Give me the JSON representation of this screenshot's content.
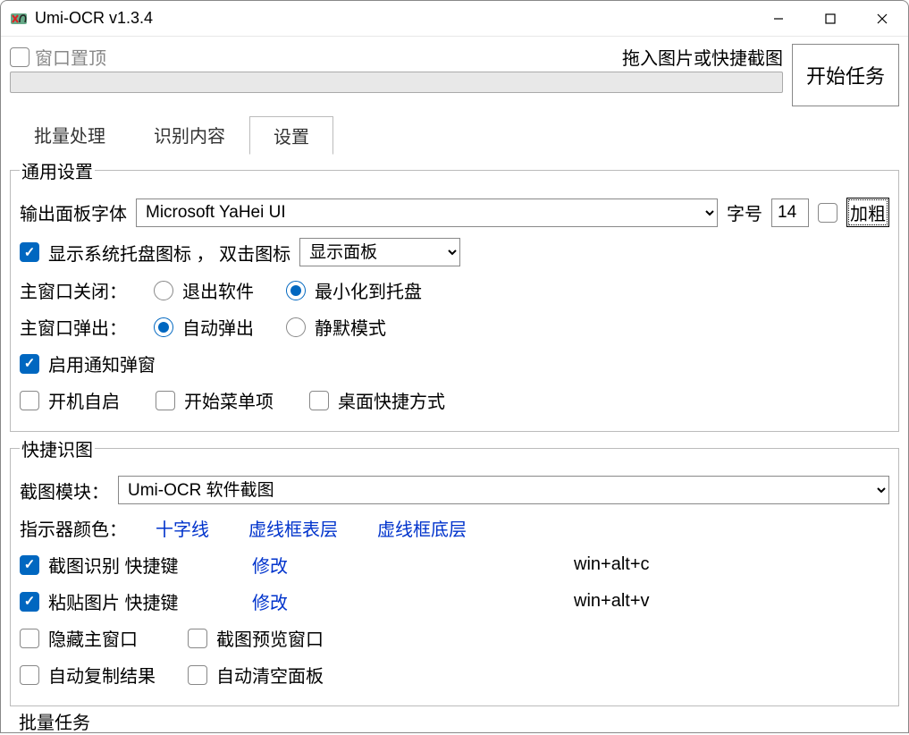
{
  "window": {
    "title": "Umi-OCR v1.3.4"
  },
  "top": {
    "pin_label": "窗口置顶",
    "pin_checked": false,
    "hint": "拖入图片或快捷截图",
    "start": "开始任务"
  },
  "tabs": {
    "batch": "批量处理",
    "result": "识别内容",
    "settings": "设置",
    "active": "settings"
  },
  "general": {
    "legend": "通用设置",
    "font_label": "输出面板字体",
    "font_value": "Microsoft YaHei UI",
    "size_label": "字号",
    "size_value": "14",
    "bold_label": "加粗",
    "bold_checked": false,
    "tray_check_label": "显示系统托盘图标 ， 双击图标",
    "tray_checked": true,
    "tray_action": "显示面板",
    "close_label": "主窗口关闭：",
    "close_opts": {
      "exit": "退出软件",
      "min": "最小化到托盘"
    },
    "close_selected": "min",
    "popup_label": "主窗口弹出：",
    "popup_opts": {
      "auto": "自动弹出",
      "silent": "静默模式"
    },
    "popup_selected": "auto",
    "notify_label": "启用通知弹窗",
    "notify_checked": true,
    "startup_label": "开机自启",
    "startup_checked": false,
    "startmenu_label": "开始菜单项",
    "startmenu_checked": false,
    "desktop_label": "桌面快捷方式",
    "desktop_checked": false
  },
  "quick": {
    "legend": "快捷识图",
    "module_label": "截图模块：",
    "module_value": "Umi-OCR 软件截图",
    "indicator_label": "指示器颜色：",
    "indicator_links": {
      "cross": "十字线",
      "top": "虚线框表层",
      "bottom": "虚线框底层"
    },
    "shot_label": "截图识别  快捷键",
    "shot_checked": true,
    "paste_label": "粘贴图片  快捷键",
    "paste_checked": true,
    "modify": "修改",
    "shot_hotkey": "win+alt+c",
    "paste_hotkey": "win+alt+v",
    "hide_label": "隐藏主窗口",
    "hide_checked": false,
    "preview_label": "截图预览窗口",
    "preview_checked": false,
    "copy_label": "自动复制结果",
    "copy_checked": false,
    "clear_label": "自动清空面板",
    "clear_checked": false
  },
  "partial": {
    "legend": "批量任务"
  }
}
